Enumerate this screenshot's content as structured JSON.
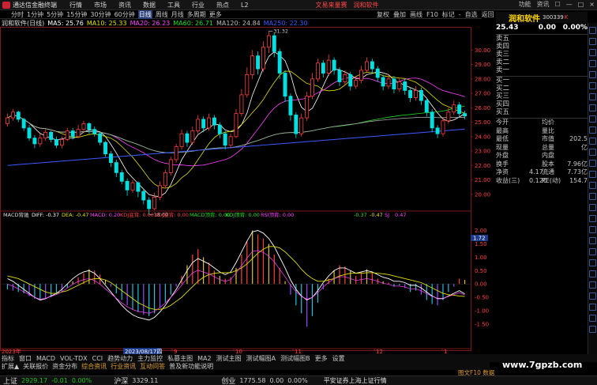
{
  "titlebar": {
    "app_title": "通达信金融终端",
    "menus": [
      "行情",
      "市场",
      "资讯",
      "数据",
      "工具",
      "行业",
      "热点",
      "L2"
    ],
    "promo1": "文易来量赛",
    "promo2": "润和软件",
    "window_controls": [
      "功能",
      "资讯",
      "☐",
      "—",
      "□",
      "×"
    ]
  },
  "toolbar": {
    "periods": [
      "分时",
      "1分钟",
      "5分钟",
      "15分钟",
      "30分钟",
      "60分钟",
      "日线",
      "周线",
      "月线",
      "多周期",
      "更多"
    ],
    "selected": "日线",
    "right_buttons": [
      "复权",
      "叠加",
      "画线",
      "F10",
      "标记",
      "-",
      "自选",
      "返回"
    ]
  },
  "quote_top": {
    "name": "润和软件",
    "code": "300339",
    "k": "K"
  },
  "infobar": {
    "stock": "润和软件(日线)",
    "ma5": "MA5: 25.76",
    "ma10": "MA10: 25.33",
    "ma20": "MA20: 26.23",
    "ma60": "MA60: 26.71",
    "ma120": "MA120: 24.84",
    "ma250": "MA250: 22.30"
  },
  "price_axis": [
    "30.00",
    "29.00",
    "28.00",
    "27.00",
    "26.00",
    "25.00",
    "24.00",
    "23.00",
    "22.00",
    "21.00",
    "20.00"
  ],
  "candle_labels": {
    "high": "31.32",
    "low": "18.60"
  },
  "macd_info": {
    "name": "MACD背驰",
    "diff": "DIFF: -0.37",
    "dea": "DEA: -0.47",
    "macd": "MACD: 0.20",
    "kdj_low": "KDJ底背: 0.00",
    "kdj_high": "KDJ底背: 0.00",
    "macd_top": "MACD顶背: 0.00",
    "kdj_top": "KDJ顶背: 0.00",
    "rsi": "RSI顶背: 0.00",
    "tail1": "-0.37",
    "tail2": "-0.47",
    "tail3": "0.47",
    "tail_label": "SJ"
  },
  "macd_axis": [
    "2.00",
    "1.72",
    "1.50",
    "1.00",
    "0.50",
    "0.00",
    "-0.50",
    "-1.00",
    "-1.50"
  ],
  "date_axis": {
    "left": "2023年",
    "marker": "2023/08/17四",
    "ticks": [
      "9",
      "10",
      "11",
      "12",
      "1"
    ]
  },
  "orderbook": {
    "price": "25.43",
    "change": "0.00",
    "pct": "0.00%",
    "sell": [
      "卖五",
      "卖四",
      "卖三",
      "卖二",
      "卖一"
    ],
    "buy": [
      "买一",
      "买二",
      "买三",
      "买四",
      "买五"
    ]
  },
  "stats": [
    {
      "l": "今开",
      "v": "",
      "l2": "均价",
      "v2": ""
    },
    {
      "l": "最高",
      "v": "",
      "l2": "量比",
      "v2": ""
    },
    {
      "l": "最低",
      "v": "",
      "l2": "市值",
      "v2": "202.5亿"
    },
    {
      "l": "现量",
      "v": "",
      "l2": "总量",
      "v2": ""
    },
    {
      "l": "外盘",
      "v": "",
      "l2": "内盘",
      "v2": ""
    },
    {
      "l": "换手",
      "v": "",
      "l2": "股本",
      "v2": "7.96亿"
    },
    {
      "l": "净资",
      "v": "4.17",
      "l2": "流通",
      "v2": "7.73亿"
    },
    {
      "l": "收益(三)",
      "v": "0.120",
      "l2": "PE(动)",
      "v2": "154.7"
    }
  ],
  "bottom_tabs": [
    "指标",
    "窗口",
    "MACD",
    "VOL-TDX",
    "CCI",
    "趋势动力",
    "主力监控",
    "私募主图",
    "MA2",
    "测试主图",
    "测试幅图A",
    "测试幅图B",
    "更多",
    "设置"
  ],
  "bottom_tabs2": [
    "扩展▲",
    "关联报价",
    "资金分布",
    "综合资讯",
    "行业资讯",
    "互动问答",
    "普及新功能说明"
  ],
  "status": {
    "sh_label": "上证",
    "sh_val": "2929.17",
    "sh_chg": "-0.01",
    "sh_pct": "0.00%",
    "hs_label": "沪深",
    "hs_val": "3329.11",
    "cy_label": "创业",
    "cy_val": "1775.58",
    "cy_chg": "0.00",
    "cy_pct": "0.00%",
    "broker": "平安证券上海上证行情",
    "right_tag": "图文F10 数据"
  },
  "watermark": "www.7gpzb.com",
  "chart_data": {
    "type": "candlestick",
    "ylim": [
      19.0,
      31.5
    ],
    "candles": [
      [
        24.9,
        25.3,
        25.6,
        24.7
      ],
      [
        25.3,
        25.7,
        25.9,
        25.1
      ],
      [
        25.7,
        25.2,
        25.8,
        25.0
      ],
      [
        25.2,
        24.6,
        25.3,
        24.4
      ],
      [
        24.6,
        23.9,
        24.8,
        23.7
      ],
      [
        23.9,
        23.5,
        24.1,
        23.2
      ],
      [
        23.5,
        23.9,
        24.2,
        23.3
      ],
      [
        23.9,
        24.3,
        24.5,
        23.7
      ],
      [
        24.3,
        23.8,
        24.4,
        23.6
      ],
      [
        23.8,
        23.4,
        24.0,
        23.2
      ],
      [
        23.4,
        23.8,
        24.0,
        23.2
      ],
      [
        23.8,
        24.4,
        24.6,
        23.7
      ],
      [
        24.4,
        24.0,
        24.6,
        23.8
      ],
      [
        24.0,
        24.5,
        24.8,
        23.9
      ],
      [
        24.5,
        24.9,
        25.1,
        24.3
      ],
      [
        24.9,
        24.5,
        25.0,
        24.2
      ],
      [
        24.5,
        24.2,
        24.7,
        24.0
      ],
      [
        24.2,
        23.6,
        24.3,
        23.4
      ],
      [
        23.6,
        22.8,
        23.7,
        22.6
      ],
      [
        22.8,
        22.2,
        23.0,
        21.9
      ],
      [
        22.2,
        21.5,
        22.4,
        21.2
      ],
      [
        21.5,
        20.9,
        21.7,
        20.7
      ],
      [
        20.9,
        20.3,
        21.1,
        19.9
      ],
      [
        20.3,
        20.8,
        21.0,
        20.1
      ],
      [
        20.8,
        20.2,
        20.9,
        19.8
      ],
      [
        20.2,
        19.6,
        20.4,
        19.3
      ],
      [
        19.6,
        19.0,
        19.8,
        18.6
      ],
      [
        19.0,
        19.8,
        20.1,
        18.9
      ],
      [
        19.8,
        20.6,
        20.9,
        19.6
      ],
      [
        20.6,
        21.5,
        21.7,
        20.4
      ],
      [
        21.5,
        22.4,
        22.6,
        21.3
      ],
      [
        22.4,
        23.3,
        23.5,
        22.2
      ],
      [
        23.3,
        24.2,
        24.5,
        23.1
      ],
      [
        24.2,
        23.6,
        24.4,
        23.3
      ],
      [
        23.6,
        24.4,
        24.7,
        23.4
      ],
      [
        24.4,
        25.2,
        25.5,
        24.2
      ],
      [
        25.2,
        24.6,
        25.4,
        24.3
      ],
      [
        24.6,
        25.3,
        25.6,
        24.4
      ],
      [
        25.3,
        24.8,
        25.5,
        24.5
      ],
      [
        24.8,
        24.2,
        25.0,
        23.9
      ],
      [
        24.2,
        23.4,
        24.4,
        23.1
      ],
      [
        23.4,
        24.0,
        24.2,
        23.2
      ],
      [
        24.0,
        25.6,
        25.9,
        23.9
      ],
      [
        25.6,
        26.9,
        27.3,
        25.4
      ],
      [
        26.9,
        28.3,
        28.8,
        26.7
      ],
      [
        28.3,
        29.6,
        30.0,
        28.0
      ],
      [
        29.6,
        28.7,
        29.9,
        28.3
      ],
      [
        28.7,
        30.2,
        30.6,
        28.5
      ],
      [
        30.2,
        31.0,
        31.32,
        29.8
      ],
      [
        31.0,
        29.9,
        31.2,
        29.5
      ],
      [
        29.9,
        28.4,
        30.1,
        28.0
      ],
      [
        28.4,
        26.8,
        28.6,
        26.4
      ],
      [
        26.8,
        25.5,
        27.0,
        25.1
      ],
      [
        25.5,
        24.2,
        25.7,
        23.9
      ],
      [
        24.2,
        25.3,
        25.6,
        24.0
      ],
      [
        25.3,
        26.8,
        27.1,
        25.1
      ],
      [
        26.8,
        28.0,
        28.4,
        26.6
      ],
      [
        28.0,
        29.1,
        29.4,
        27.8
      ],
      [
        29.1,
        28.4,
        29.3,
        28.1
      ],
      [
        28.4,
        29.3,
        29.7,
        28.2
      ],
      [
        29.3,
        28.6,
        29.5,
        28.3
      ],
      [
        28.6,
        27.8,
        28.8,
        27.5
      ],
      [
        27.8,
        28.3,
        28.6,
        27.6
      ],
      [
        28.3,
        27.5,
        28.5,
        27.2
      ],
      [
        27.5,
        27.9,
        28.2,
        27.3
      ],
      [
        27.9,
        28.6,
        28.9,
        27.7
      ],
      [
        28.6,
        29.2,
        29.5,
        28.4
      ],
      [
        29.2,
        28.7,
        29.4,
        28.4
      ],
      [
        28.7,
        28.1,
        28.9,
        27.8
      ],
      [
        28.1,
        27.5,
        28.3,
        27.2
      ],
      [
        27.5,
        28.0,
        28.3,
        27.3
      ],
      [
        28.0,
        27.3,
        28.2,
        27.0
      ],
      [
        27.3,
        27.8,
        28.1,
        27.1
      ],
      [
        27.8,
        27.2,
        28.0,
        26.9
      ],
      [
        27.2,
        26.7,
        27.4,
        26.4
      ],
      [
        26.7,
        27.2,
        27.5,
        26.5
      ],
      [
        27.2,
        26.5,
        27.4,
        26.2
      ],
      [
        26.5,
        25.7,
        26.7,
        25.4
      ],
      [
        25.7,
        24.6,
        25.9,
        24.3
      ],
      [
        24.6,
        24.2,
        24.8,
        23.9
      ],
      [
        24.2,
        25.1,
        25.3,
        24.0
      ],
      [
        25.1,
        25.7,
        26.0,
        24.9
      ],
      [
        25.7,
        26.2,
        26.5,
        25.5
      ],
      [
        26.2,
        25.6,
        26.4,
        25.4
      ],
      [
        25.6,
        25.43,
        25.8,
        25.2
      ]
    ],
    "macd_hist": [
      -0.2,
      -0.25,
      -0.3,
      -0.35,
      -0.45,
      -0.55,
      -0.6,
      -0.55,
      -0.5,
      -0.4,
      -0.3,
      -0.15,
      0.1,
      0.25,
      0.4,
      0.55,
      0.5,
      0.35,
      0.15,
      -0.1,
      -0.35,
      -0.6,
      -0.8,
      -0.95,
      -1.05,
      -1.15,
      -1.2,
      -1.1,
      -0.9,
      -0.7,
      -0.4,
      -0.1,
      0.3,
      0.7,
      1.1,
      1.3,
      1.0,
      0.8,
      0.5,
      0.3,
      0.2,
      0.25,
      0.6,
      1.1,
      1.6,
      2.0,
      1.85,
      1.7,
      1.5,
      1.1,
      0.6,
      0.1,
      -0.4,
      -0.8,
      -1.1,
      -1.6,
      -1.2,
      -0.7,
      -0.2,
      0.2,
      0.5,
      0.7,
      0.65,
      0.5,
      0.3,
      0.45,
      0.55,
      0.4,
      0.2,
      0.1,
      0.05,
      -0.1,
      -0.05,
      -0.15,
      -0.3,
      -0.25,
      -0.4,
      -0.6,
      -0.75,
      -0.8,
      -0.6,
      -0.3,
      -0.1,
      0.2,
      0.15
    ],
    "diff": [
      0.2,
      0.1,
      -0.05,
      -0.2,
      -0.35,
      -0.5,
      -0.6,
      -0.55,
      -0.45,
      -0.35,
      -0.2,
      0.0,
      0.2,
      0.35,
      0.45,
      0.5,
      0.4,
      0.2,
      -0.05,
      -0.3,
      -0.55,
      -0.8,
      -1.0,
      -1.15,
      -1.25,
      -1.3,
      -1.35,
      -1.25,
      -1.05,
      -0.8,
      -0.5,
      -0.2,
      0.15,
      0.5,
      0.8,
      0.95,
      0.85,
      0.75,
      0.6,
      0.45,
      0.35,
      0.45,
      0.8,
      1.2,
      1.6,
      1.95,
      2.0,
      1.9,
      1.7,
      1.4,
      1.0,
      0.6,
      0.15,
      -0.2,
      -0.45,
      -0.6,
      -0.5,
      -0.25,
      0.05,
      0.3,
      0.5,
      0.6,
      0.6,
      0.5,
      0.4,
      0.45,
      0.5,
      0.45,
      0.35,
      0.25,
      0.2,
      0.1,
      0.1,
      0.05,
      -0.05,
      -0.05,
      -0.15,
      -0.3,
      -0.45,
      -0.55,
      -0.55,
      -0.45,
      -0.35,
      -0.25,
      -0.37
    ],
    "dea": [
      0.3,
      0.25,
      0.2,
      0.1,
      0.0,
      -0.1,
      -0.2,
      -0.3,
      -0.35,
      -0.35,
      -0.3,
      -0.25,
      -0.15,
      -0.05,
      0.05,
      0.15,
      0.2,
      0.2,
      0.15,
      0.05,
      -0.1,
      -0.25,
      -0.4,
      -0.55,
      -0.7,
      -0.8,
      -0.9,
      -0.95,
      -0.95,
      -0.9,
      -0.8,
      -0.65,
      -0.5,
      -0.3,
      -0.1,
      0.1,
      0.25,
      0.35,
      0.4,
      0.42,
      0.42,
      0.42,
      0.5,
      0.6,
      0.75,
      0.95,
      1.15,
      1.3,
      1.4,
      1.4,
      1.35,
      1.2,
      1.0,
      0.8,
      0.55,
      0.35,
      0.2,
      0.1,
      0.1,
      0.15,
      0.2,
      0.3,
      0.35,
      0.4,
      0.4,
      0.4,
      0.42,
      0.42,
      0.4,
      0.38,
      0.35,
      0.3,
      0.25,
      0.2,
      0.15,
      0.1,
      0.05,
      -0.05,
      -0.15,
      -0.25,
      -0.35,
      -0.4,
      -0.42,
      -0.45,
      -0.47
    ],
    "macd_ylim": [
      -2.3,
      2.4
    ]
  }
}
